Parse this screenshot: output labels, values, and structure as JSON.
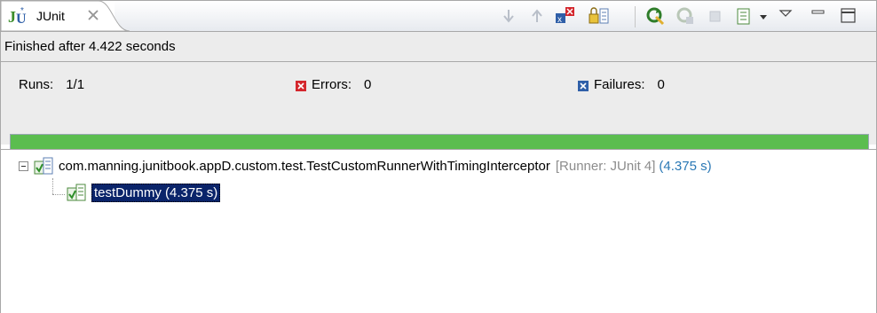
{
  "tab": {
    "title": "JUnit",
    "icon": "junit-icon"
  },
  "toolbar": {
    "buttons": [
      {
        "name": "next-failure-icon"
      },
      {
        "name": "previous-failure-icon"
      },
      {
        "name": "show-failures-only-icon"
      },
      {
        "name": "scroll-lock-icon"
      },
      {
        "name": "rerun-test-icon"
      },
      {
        "name": "rerun-failed-first-icon"
      },
      {
        "name": "stop-icon"
      },
      {
        "name": "test-run-history-icon"
      },
      {
        "name": "view-menu-icon"
      },
      {
        "name": "minimize-icon"
      },
      {
        "name": "maximize-icon"
      }
    ]
  },
  "status": {
    "text": "Finished after 4.422 seconds"
  },
  "counters": {
    "runs_label": "Runs:",
    "runs_value": "1/1",
    "errors_label": "Errors:",
    "errors_value": "0",
    "failures_label": "Failures:",
    "failures_value": "0"
  },
  "progress": {
    "fraction": 1.0,
    "color": "#5bbd4f"
  },
  "tree": {
    "suite": {
      "name": "com.manning.junitbook.appD.custom.test.TestCustomRunnerWithTimingInterceptor",
      "runner": "[Runner: JUnit 4]",
      "time": "(4.375 s)"
    },
    "test": {
      "label": "testDummy (4.375 s)"
    }
  },
  "colors": {
    "error": "#d4262c",
    "failure": "#2f5fa8",
    "time": "#2a78b5"
  }
}
